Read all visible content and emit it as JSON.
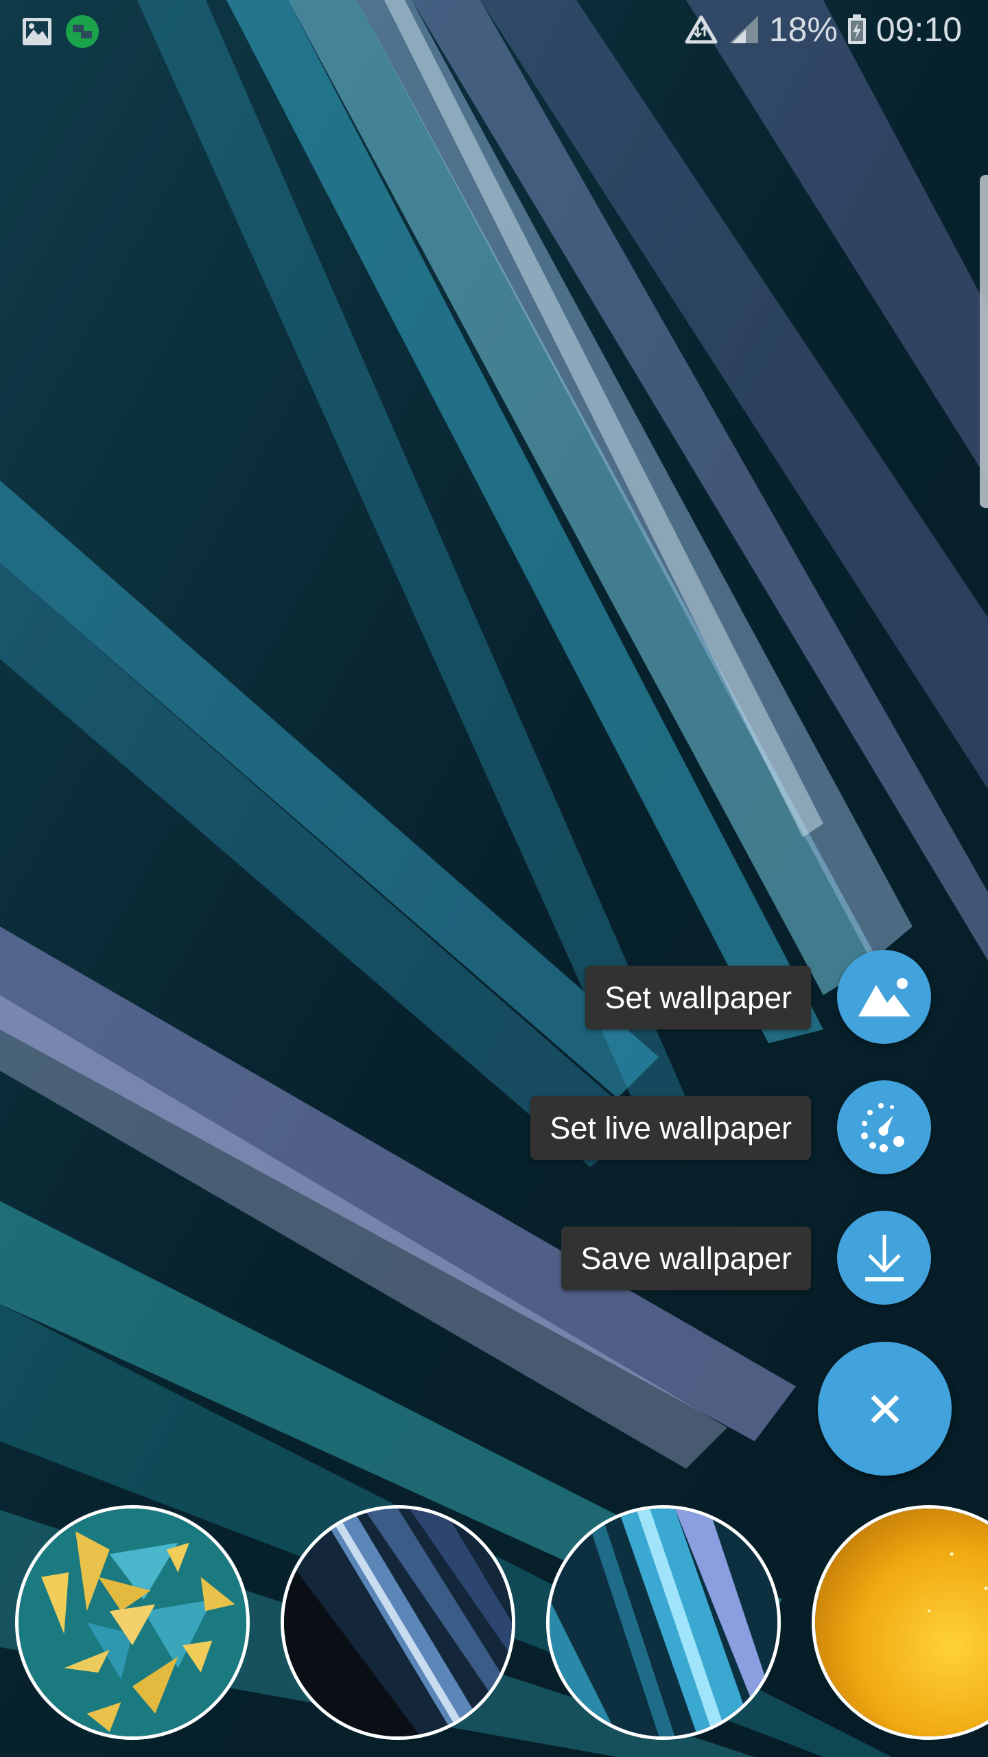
{
  "status_bar": {
    "left_icons": [
      "gallery-notification-icon",
      "messaging-app-notification-icon"
    ],
    "right_icons": [
      "data-saver-icon",
      "signal-strength-icon",
      "battery-charging-icon"
    ],
    "battery_percent": "18%",
    "time": "09:10"
  },
  "speed_dial": {
    "actions": [
      {
        "label": "Set wallpaper",
        "icon": "landscape-image-icon"
      },
      {
        "label": "Set live wallpaper",
        "icon": "live-wallpaper-dial-icon"
      },
      {
        "label": "Save wallpaper",
        "icon": "download-icon"
      }
    ],
    "close_icon": "close-icon"
  },
  "colors": {
    "fab": "#42a2dc",
    "label_bg": "#323232",
    "label_text": "#ffffff"
  },
  "thumbnails": [
    {
      "name": "gold-teal-shards-wallpaper"
    },
    {
      "name": "dark-blue-streaks-wallpaper"
    },
    {
      "name": "cyan-light-streaks-wallpaper"
    },
    {
      "name": "golden-glow-wallpaper"
    }
  ]
}
